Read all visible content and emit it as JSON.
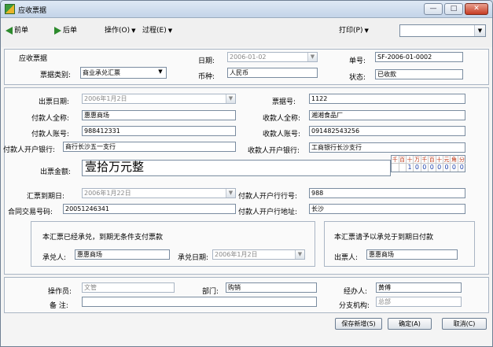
{
  "window": {
    "title": "应收票据",
    "controls": {
      "minimize": "—",
      "maximize": "□",
      "close": "✕"
    }
  },
  "toolbar": {
    "prev": "前单",
    "next": "后单",
    "operate": "操作(O)",
    "process": "过程(E)",
    "print": "打印(P)",
    "print_value": ""
  },
  "header": {
    "section_title": "应收票据",
    "type_label": "票据类别:",
    "type_value": "商业承兑汇票",
    "date_label": "日期:",
    "date_value": "2006-01-02",
    "currency_label": "币种:",
    "currency_value": "人民币",
    "docno_label": "单号:",
    "docno_value": "SF-2006-01-0002",
    "status_label": "状态:",
    "status_value": "已收款"
  },
  "body": {
    "issue_date_label": "出票日期:",
    "issue_date_value": "2006年1月2日",
    "bill_no_label": "票据号:",
    "bill_no_value": "1122",
    "payer_name_label": "付款人全称:",
    "payer_name_value": "惠惠商场",
    "payee_name_label": "收款人全称:",
    "payee_name_value": "湘湘食品厂",
    "payer_acct_label": "付款人账号:",
    "payer_acct_value": "988412331",
    "payee_acct_label": "收款人账号:",
    "payee_acct_value": "091482543256",
    "payer_bank_label": "付款人开户银行:",
    "payer_bank_value": "商行长沙五一支行",
    "payee_bank_label": "收款人开户银行:",
    "payee_bank_value": "工商银行长沙支行",
    "amount_label": "出票金额:",
    "amount_words": "壹拾万元整",
    "amount_grid": {
      "heads": [
        "千",
        "百",
        "十",
        "万",
        "千",
        "百",
        "十",
        "元",
        "角",
        "分"
      ],
      "digits": [
        "",
        "",
        "1",
        "0",
        "0",
        "0",
        "0",
        "0",
        "0",
        "0"
      ]
    },
    "due_date_label": "汇票到期日:",
    "due_date_value": "2006年1月22日",
    "payer_bank_no_label": "付款人开户行行号:",
    "payer_bank_no_value": "988",
    "contract_label": "合同交易号码:",
    "contract_value": "20051246341",
    "payer_bank_addr_label": "付款人开户行地址:",
    "payer_bank_addr_value": "长沙"
  },
  "accept": {
    "left_text": "本汇票已经承兑，到期无条件支付票款",
    "acceptor_label": "承兑人:",
    "acceptor_value": "惠惠商场",
    "accept_date_label": "承兑日期:",
    "accept_date_value": "2006年1月2日",
    "right_text": "本汇票请予以承兑于到期日付款",
    "drawer_label": "出票人:",
    "drawer_value": "惠惠商场"
  },
  "footer": {
    "operator_label": "操作员:",
    "operator_value": "文管",
    "dept_label": "部门:",
    "dept_value": "购销",
    "handler_label": "经办人:",
    "handler_value": "黄傅",
    "note_label": "备  注:",
    "note_value": "",
    "branch_label": "分支机构:",
    "branch_value": "总部"
  },
  "buttons": {
    "save_new": "保存新增(S)",
    "ok": "确定(A)",
    "cancel": "取消(C)"
  }
}
